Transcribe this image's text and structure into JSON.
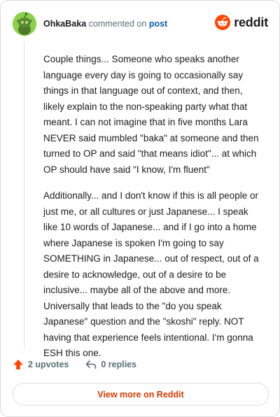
{
  "header": {
    "username": "OhkaBaka",
    "action_text": "commented on",
    "post_link": "post",
    "logo_text": "reddit"
  },
  "comment": {
    "paragraphs": [
      "Couple things... Someone who speaks another language every day is going to occasionally say things in that language out of context, and then, likely explain to the non-speaking party what that meant. I can not imagine that in five months Lara NEVER said mumbled \"baka\" at someone and then turned to OP and said \"that means idiot\"... at which OP should have said \"I know, I'm fluent\"",
      "Additionally... and I don't know if this is all people or just me, or all cultures or just Japanese... I speak like 10 words of Japanese... and if I go into a home where Japanese is spoken I'm going to say SOMETHING in Japanese... out of respect, out of a desire to acknowledge, out of a desire to be inclusive... maybe all of the above and more. Universally that leads to the \"do you speak Japanese\" question and the \"skoshi\" reply. NOT having that experience feels intentional. I'm gonna ESH this one."
    ]
  },
  "actions": {
    "upvotes": "2 upvotes",
    "replies": "0 replies"
  },
  "footer": {
    "view_more": "View more on Reddit"
  },
  "colors": {
    "brand": "#ff4500",
    "link": "#0a5fb4",
    "avatar_bg": "#8cd04a"
  }
}
